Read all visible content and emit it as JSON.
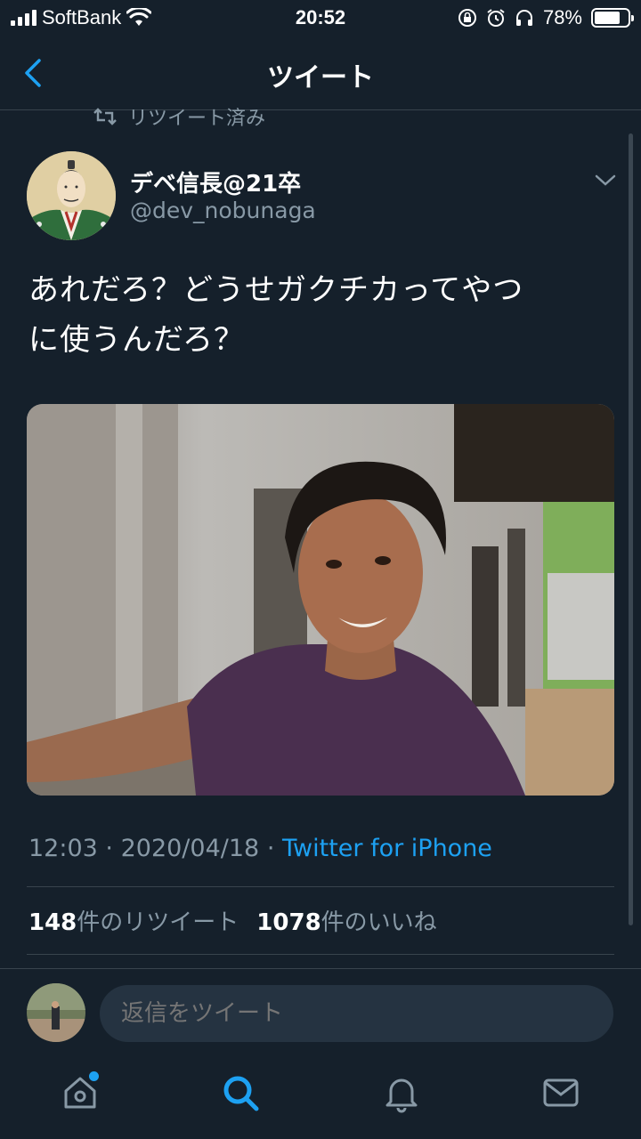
{
  "status_bar": {
    "carrier": "SoftBank",
    "time": "20:52",
    "battery_percent": "78%",
    "battery_level": 0.78
  },
  "header": {
    "title": "ツイート"
  },
  "retweet_indicator": "リツイート済み",
  "tweet": {
    "author_name": "デベ信長@21卒",
    "author_handle": "@dev_nobunaga",
    "text_line1": "あれだろ？どうせガクチカってやつ",
    "text_line2": "に使うんだろ？",
    "time": "12:03",
    "separator": "·",
    "date": "2020/04/18",
    "source": "Twitter for iPhone",
    "retweet_count": "148",
    "retweet_label": "件のリツイート",
    "like_count": "1078",
    "like_label": "件のいいね"
  },
  "reply": {
    "placeholder": "返信をツイート"
  },
  "tab_bar": {
    "items": [
      "home-icon",
      "search-icon",
      "notifications-icon",
      "messages-icon"
    ],
    "active": "search-icon"
  },
  "colors": {
    "background": "#15202b",
    "accent": "#1da1f2",
    "secondary_text": "#8899a6",
    "divider": "#38444d"
  }
}
